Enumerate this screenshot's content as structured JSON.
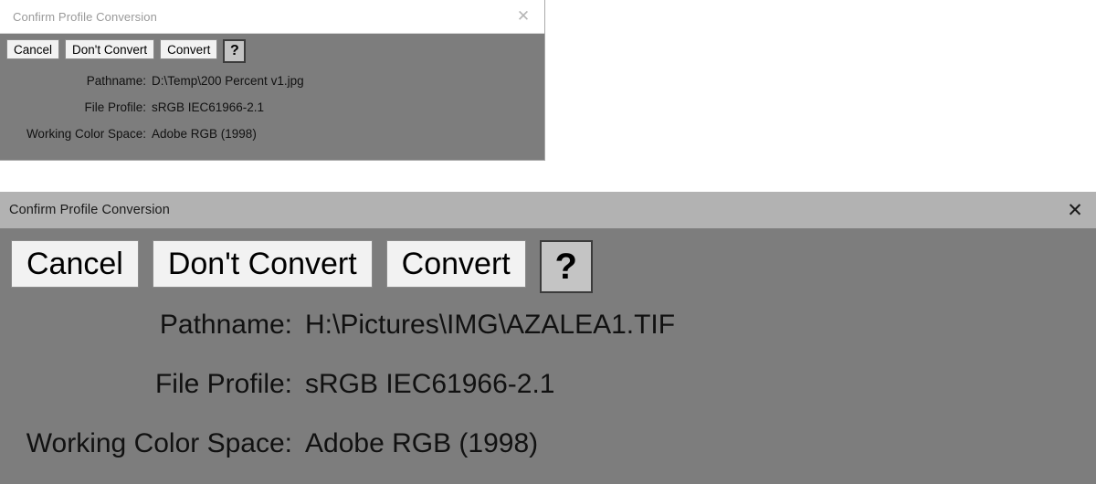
{
  "page": {
    "background_color": "#ffffff"
  },
  "dialog_small": {
    "title": "Confirm Profile Conversion",
    "close_icon": "close-icon",
    "close_glyph": "✕",
    "titlebar_color": "#ffffff",
    "body_color": "#7d7d7d",
    "buttons": [
      {
        "label": "Cancel",
        "name": "cancel-button"
      },
      {
        "label": "Don't Convert",
        "name": "dont-convert-button"
      },
      {
        "label": "Convert",
        "name": "convert-button"
      }
    ],
    "help_button": {
      "label": "?",
      "name": "help-button"
    },
    "info": [
      {
        "label": "Pathname:",
        "value": "D:\\Temp\\200 Percent v1.jpg"
      },
      {
        "label": "File Profile:",
        "value": "sRGB IEC61966-2.1"
      },
      {
        "label": "Working Color Space:",
        "value": "Adobe RGB (1998)"
      }
    ]
  },
  "dialog_large": {
    "title": "Confirm Profile Conversion",
    "close_icon": "close-icon",
    "close_glyph": "✕",
    "titlebar_color": "#b2b2b2",
    "body_color": "#7d7d7d",
    "buttons": [
      {
        "label": "Cancel",
        "name": "cancel-button"
      },
      {
        "label": "Don't Convert",
        "name": "dont-convert-button"
      },
      {
        "label": "Convert",
        "name": "convert-button"
      }
    ],
    "help_button": {
      "label": "?",
      "name": "help-button"
    },
    "info": [
      {
        "label": "Pathname:",
        "value": "H:\\Pictures\\IMG\\AZALEA1.TIF"
      },
      {
        "label": "File Profile:",
        "value": "sRGB IEC61966-2.1"
      },
      {
        "label": "Working Color Space:",
        "value": "Adobe RGB (1998)"
      }
    ]
  }
}
